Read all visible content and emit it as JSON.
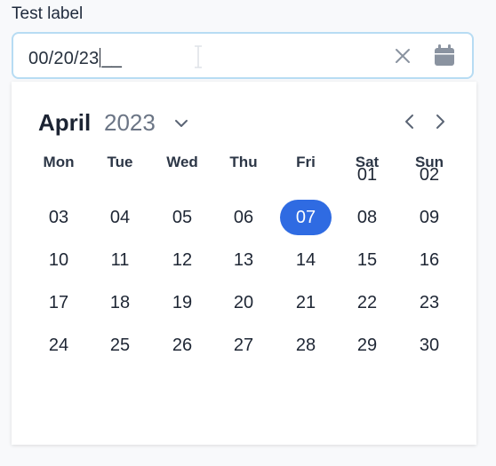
{
  "field": {
    "label": "Test label",
    "value": "00/20/23",
    "mask_remainder": "__"
  },
  "icons": {
    "clear": "close-icon",
    "calendar": "calendar-icon",
    "year_toggle": "chevron-down-icon",
    "prev": "chevron-left-icon",
    "next": "chevron-right-icon"
  },
  "calendar": {
    "month": "April",
    "year": "2023",
    "weekdays": [
      "Mon",
      "Tue",
      "Wed",
      "Thu",
      "Fri",
      "Sat",
      "Sun"
    ],
    "weeks": [
      [
        "",
        "",
        "",
        "",
        "",
        "01",
        "02"
      ],
      [
        "03",
        "04",
        "05",
        "06",
        "07",
        "08",
        "09"
      ],
      [
        "10",
        "11",
        "12",
        "13",
        "14",
        "15",
        "16"
      ],
      [
        "17",
        "18",
        "19",
        "20",
        "21",
        "22",
        "23"
      ],
      [
        "24",
        "25",
        "26",
        "27",
        "28",
        "29",
        "30"
      ]
    ],
    "selected_day": "07"
  },
  "colors": {
    "accent": "#2f6be2",
    "input_border": "#b7dcf3",
    "icon_gray": "#8a93a0"
  }
}
